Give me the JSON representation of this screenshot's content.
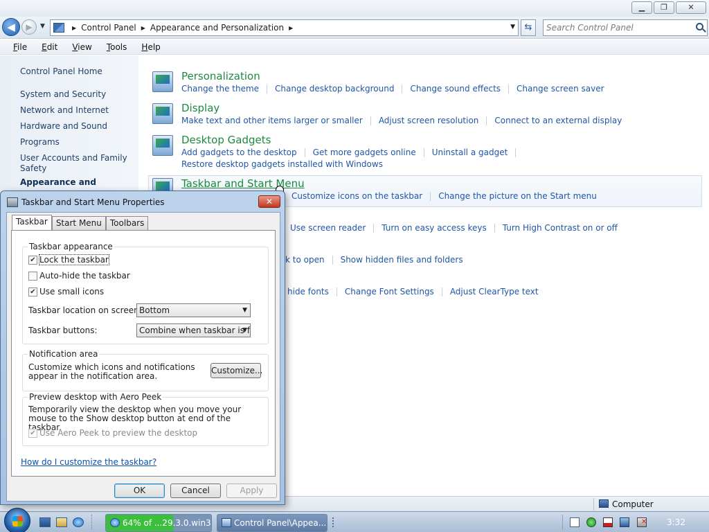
{
  "window": {
    "minimize_icon": "minimize-icon",
    "maximize_icon": "restore-icon",
    "close_icon": "close-icon",
    "minimize_glyph": "▁",
    "restore_glyph": "❐",
    "close_glyph": "✕"
  },
  "address": {
    "crumbs": [
      "Control Panel",
      "Appearance and Personalization"
    ],
    "search_placeholder": "Search Control Panel"
  },
  "menu": [
    "File",
    "Edit",
    "View",
    "Tools",
    "Help"
  ],
  "sidebar": {
    "home": "Control Panel Home",
    "items": [
      "System and Security",
      "Network and Internet",
      "Hardware and Sound",
      "Programs",
      "User Accounts and Family Safety",
      "Appearance and"
    ],
    "current_index": 5
  },
  "categories": [
    {
      "title": "Personalization",
      "links": [
        "Change the theme",
        "Change desktop background",
        "Change sound effects",
        "Change screen saver"
      ]
    },
    {
      "title": "Display",
      "links": [
        "Make text and other items larger or smaller",
        "Adjust screen resolution",
        "Connect to an external display"
      ]
    },
    {
      "title": "Desktop Gadgets",
      "links": [
        "Add gadgets to the desktop",
        "Get more gadgets online",
        "Uninstall a gadget"
      ],
      "links2": [
        "Restore desktop gadgets installed with Windows"
      ]
    },
    {
      "title": "Taskbar and Start Menu",
      "links": [
        "Customize icons on the taskbar",
        "Change the picture on the Start menu"
      ]
    },
    {
      "links": [
        "Use screen reader",
        "Turn on easy access keys",
        "Turn High Contrast on or off"
      ]
    },
    {
      "links": [
        "k to open",
        "Show hidden files and folders"
      ]
    },
    {
      "links": [
        "hide fonts",
        "Change Font Settings",
        "Adjust ClearType text"
      ]
    }
  ],
  "statusbar": {
    "location": "Computer"
  },
  "taskbar": {
    "buttons": [
      "64% of ...29.3.0.win3...",
      "Control Panel\\Appea..."
    ],
    "progress_fraction": 0.64,
    "clock": "3:32"
  },
  "dialog": {
    "title": "Taskbar and Start Menu Properties",
    "close_glyph": "✕",
    "tabs": [
      "Taskbar",
      "Start Menu",
      "Toolbars"
    ],
    "appearance_group": "Taskbar appearance",
    "lock_taskbar": {
      "label": "Lock the taskbar",
      "checked": true
    },
    "auto_hide": {
      "label": "Auto-hide the taskbar",
      "checked": false
    },
    "small_icons": {
      "label": "Use small icons",
      "checked": true
    },
    "location_label": "Taskbar location on screen:",
    "location_value": "Bottom",
    "buttons_label": "Taskbar buttons:",
    "buttons_value": "Combine when taskbar is full",
    "notification_group": "Notification area",
    "notification_text": "Customize which icons and notifications appear in the notification area.",
    "customize_button": "Customize...",
    "peek_group": "Preview desktop with Aero Peek",
    "peek_text": "Temporarily view the desktop when you move your mouse to the Show desktop button at end of the taskbar.",
    "peek_checkbox": {
      "label": "Use Aero Peek to preview the desktop",
      "checked": true,
      "enabled": false
    },
    "help_link": "How do I customize the taskbar?",
    "ok": "OK",
    "cancel": "Cancel",
    "apply": "Apply"
  }
}
